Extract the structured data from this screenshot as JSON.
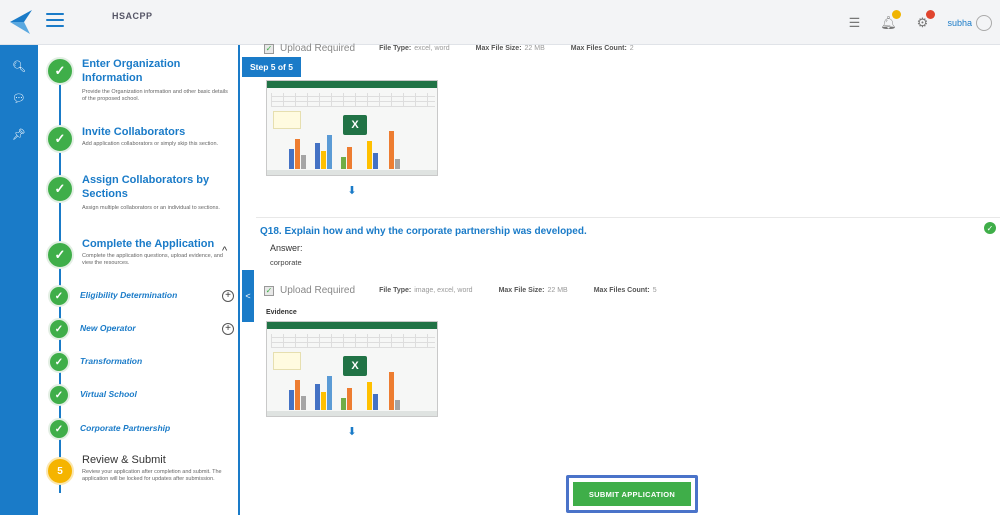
{
  "header": {
    "title": "HSACPP",
    "user_name": "subha",
    "accent_color": "#1a7bc8",
    "badge_colors": [
      "#f0b400",
      "#e0452f"
    ]
  },
  "rail": {
    "icons": [
      "search-icon",
      "chat-icon",
      "pin-icon"
    ]
  },
  "steps": {
    "items": [
      {
        "title": "Enter Organization Information",
        "description": "Provide the Organization information and other basic details of the proposed school.",
        "status": "complete"
      },
      {
        "title": "Invite Collaborators",
        "description": "Add application collaborators or simply skip this section.",
        "status": "complete"
      },
      {
        "title": "Assign Collaborators by Sections",
        "description": "Assign multiple collaborators or an individual to sections.",
        "status": "complete"
      },
      {
        "title": "Complete the Application",
        "description": "Complete the application questions, upload evidence, and view the resources.",
        "status": "complete"
      }
    ],
    "sub_items": [
      {
        "label": "Eligibility Determination",
        "has_add": true
      },
      {
        "label": "New Operator",
        "has_add": true
      },
      {
        "label": "Transformation",
        "has_add": false
      },
      {
        "label": "Virtual School",
        "has_add": false
      },
      {
        "label": "Corporate Partnership",
        "has_add": false
      }
    ],
    "final": {
      "number": "5",
      "title": "Review & Submit",
      "description": "Review your application after completion and submit. The application will be locked for updates after submission."
    }
  },
  "main": {
    "step_badge": "Step 5 of 5",
    "upload_top": {
      "checkbox_label": "Upload Required",
      "file_type_label": "File Type:",
      "file_type_value": "excel, word",
      "max_size_label": "Max File Size:",
      "max_size_value": "22 MB",
      "max_count_label": "Max Files Count:",
      "max_count_value": "2"
    },
    "question": {
      "title": "Q18. Explain how and why the corporate partnership was developed.",
      "answer_label": "Answer:",
      "answer_value": "corporate",
      "upload": {
        "checkbox_label": "Upload Required",
        "file_type_label": "File Type:",
        "file_type_value": "image, excel, word",
        "max_size_label": "Max File Size:",
        "max_size_value": "22 MB",
        "max_count_label": "Max Files Count:",
        "max_count_value": "5"
      },
      "evidence_label": "Evidence"
    },
    "submit_label": "SUBMIT APPLICATION"
  }
}
